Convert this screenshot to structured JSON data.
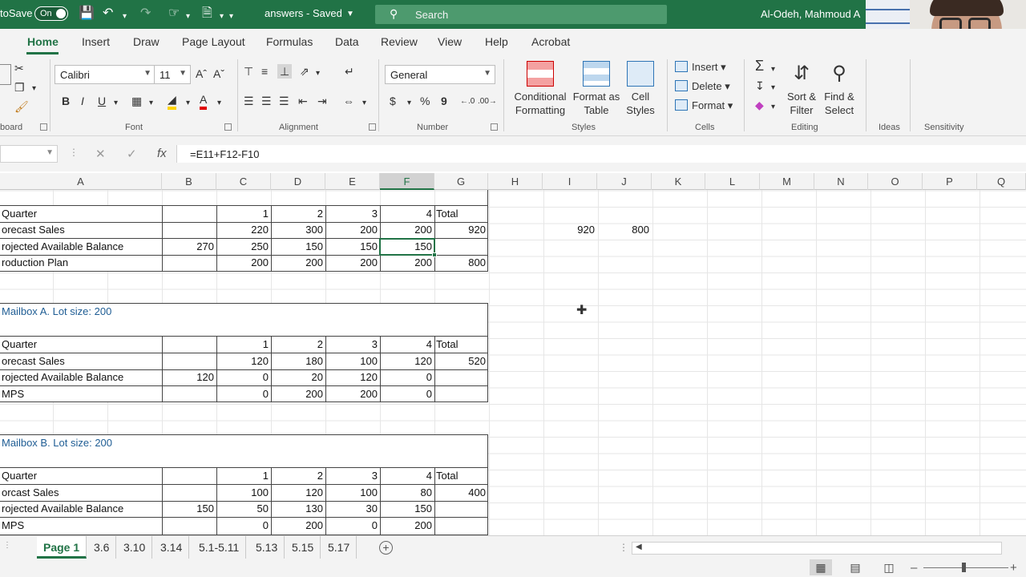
{
  "titlebar": {
    "autosave_label": "toSave",
    "autosave_state": "On",
    "file_title": "answers - Saved",
    "search_placeholder": "Search",
    "user": "Al-Odeh, Mahmoud A"
  },
  "ribbon_tabs": [
    "Home",
    "Insert",
    "Draw",
    "Page Layout",
    "Formulas",
    "Data",
    "Review",
    "View",
    "Help",
    "Acrobat"
  ],
  "ribbon": {
    "font_name": "Calibri",
    "font_size": "11",
    "number_format": "General",
    "groups": {
      "clipboard": "board",
      "font": "Font",
      "alignment": "Alignment",
      "number": "Number",
      "styles": "Styles",
      "cells": "Cells",
      "editing": "Editing",
      "ideas": "Ideas",
      "sensitivity": "Sensitivity"
    },
    "styles": {
      "conditional_1": "Conditional",
      "conditional_2": "Formatting",
      "table_1": "Format as",
      "table_2": "Table",
      "cell_1": "Cell",
      "cell_2": "Styles"
    },
    "cells": {
      "insert": "Insert",
      "delete": "Delete",
      "format": "Format"
    },
    "editing": {
      "sort_1": "Sort &",
      "sort_2": "Filter",
      "find_1": "Find &",
      "find_2": "Select"
    },
    "font_buttons": {
      "bold": "B",
      "italic": "I",
      "underline": "U"
    },
    "number_buttons": {
      "currency": "$",
      "percent": "%",
      "comma": "9"
    }
  },
  "formula_bar": {
    "formula": "=E11+F12-F10",
    "fx": "fx"
  },
  "columns": [
    "A",
    "B",
    "C",
    "D",
    "E",
    "F",
    "G",
    "H",
    "I",
    "J",
    "K",
    "L",
    "M",
    "N",
    "O",
    "P",
    "Q"
  ],
  "selected_column": "F",
  "cells": {
    "t1": {
      "r1": [
        "Quarter",
        "",
        "1",
        "2",
        "3",
        "4",
        "Total"
      ],
      "r2": [
        "orecast Sales",
        "",
        "220",
        "300",
        "200",
        "200",
        "920"
      ],
      "r3": [
        "rojected Available Balance",
        "270",
        "250",
        "150",
        "150",
        "150",
        ""
      ],
      "r4": [
        "roduction Plan",
        "",
        "200",
        "200",
        "200",
        "200",
        "800"
      ]
    },
    "side": {
      "i": "920",
      "j": "800"
    },
    "mbA": {
      "title": "Mailbox A.  Lot size: 200",
      "r1": [
        "Quarter",
        "",
        "1",
        "2",
        "3",
        "4",
        "Total"
      ],
      "r2": [
        "orecast Sales",
        "",
        "120",
        "180",
        "100",
        "120",
        "520"
      ],
      "r3": [
        "rojected Available Balance",
        "120",
        "0",
        "20",
        "120",
        "0",
        ""
      ],
      "r4": [
        "MPS",
        "",
        "0",
        "200",
        "200",
        "0",
        ""
      ]
    },
    "mbB": {
      "title": "Mailbox B.  Lot size: 200",
      "r1": [
        "Quarter",
        "",
        "1",
        "2",
        "3",
        "4",
        "Total"
      ],
      "r2": [
        "orcast Sales",
        "",
        "100",
        "120",
        "100",
        "80",
        "400"
      ],
      "r3": [
        "rojected Available Balance",
        "150",
        "50",
        "130",
        "30",
        "150",
        ""
      ],
      "r4": [
        "MPS",
        "",
        "0",
        "200",
        "0",
        "200",
        ""
      ]
    }
  },
  "sheet_tabs": [
    "Page 1",
    "3.6",
    "3.10",
    "3.14",
    "5.1-5.11",
    "5.13",
    "5.15",
    "5.17"
  ],
  "active_sheet": "Page 1",
  "icons": {
    "undo": "undo-icon",
    "search": "search-icon",
    "cursor": "cell-cursor-icon"
  }
}
